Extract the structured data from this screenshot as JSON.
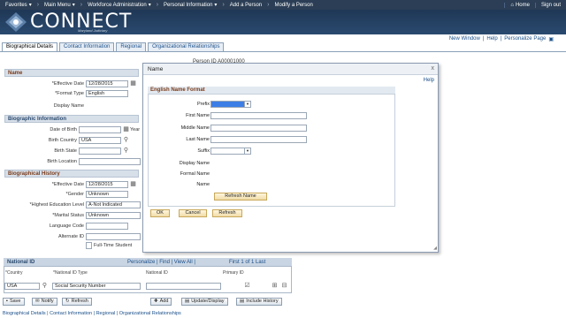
{
  "topnav": {
    "items": [
      "Favorites",
      "Main Menu",
      "Workforce Administration",
      "Personal Information",
      "Add a Person",
      "Modify a Person"
    ],
    "home": "Home",
    "signout": "Sign out"
  },
  "brand": {
    "name": "CONNECT",
    "sub": "Maryland Judiciary"
  },
  "util": {
    "new_window": "New Window",
    "help": "Help",
    "personalize": "Personalize Page"
  },
  "tabs": [
    "Biographical Details",
    "Contact Information",
    "Regional",
    "Organizational Relationships"
  ],
  "person_id": "Person ID  A00001000",
  "name_section": {
    "header": "Name",
    "effective_date_label": "*Effective Date",
    "effective_date": "12/28/2015",
    "format_type_label": "*Format Type",
    "format_type": "English",
    "display_name_label": "Display Name"
  },
  "bio_section": {
    "header": "Biographic Information",
    "dob_label": "Date of Birth",
    "years_label": "Year",
    "birth_country_label": "Birth Country",
    "birth_country": "USA",
    "birth_state_label": "Birth State",
    "birth_location_label": "Birth Location"
  },
  "history_section": {
    "header": "Biographical History",
    "effective_date_label": "*Effective Date",
    "effective_date": "12/28/2015",
    "gender_label": "*Gender",
    "gender": "Unknown",
    "education_label": "*Highest Education Level",
    "education": "A-Not Indicated",
    "marital_label": "*Marital Status",
    "marital": "Unknown",
    "language_label": "Language Code",
    "alternate_label": "Alternate ID",
    "fulltime_label": "Full-Time Student"
  },
  "national_id": {
    "title": "National ID",
    "nav": "Personalize | Find | View All |",
    "pager": "First   1 of 1   Last",
    "cols": [
      "*Country",
      "*National ID Type",
      "National ID",
      "Primary ID"
    ],
    "row": {
      "country": "USA",
      "type": "Social Security Number"
    }
  },
  "buttons": {
    "save": "Save",
    "notify": "Notify",
    "refresh": "Refresh",
    "add": "Add",
    "update": "Update/Display",
    "include_history": "Include History"
  },
  "footer": "Biographical Details | Contact Information | Regional | Organizational Relationships",
  "modal": {
    "title": "Name",
    "close": "x",
    "help": "Help",
    "section": "English Name Format",
    "prefix_label": "Prefix",
    "first_label": "First Name",
    "middle_label": "Middle Name",
    "last_label": "Last Name",
    "suffix_label": "Suffix",
    "display_label": "Display Name",
    "formal_label": "Formal Name",
    "name_label": "Name",
    "refresh_name": "Refresh Name",
    "ok": "OK",
    "cancel": "Cancel",
    "refresh": "Refresh"
  },
  "colors": {
    "nav_bg": "#2b3e55",
    "banner": "#1f3756",
    "link": "#1a4f8a",
    "section_text": "#7a3b1a",
    "selected": "#3d7ee6"
  }
}
